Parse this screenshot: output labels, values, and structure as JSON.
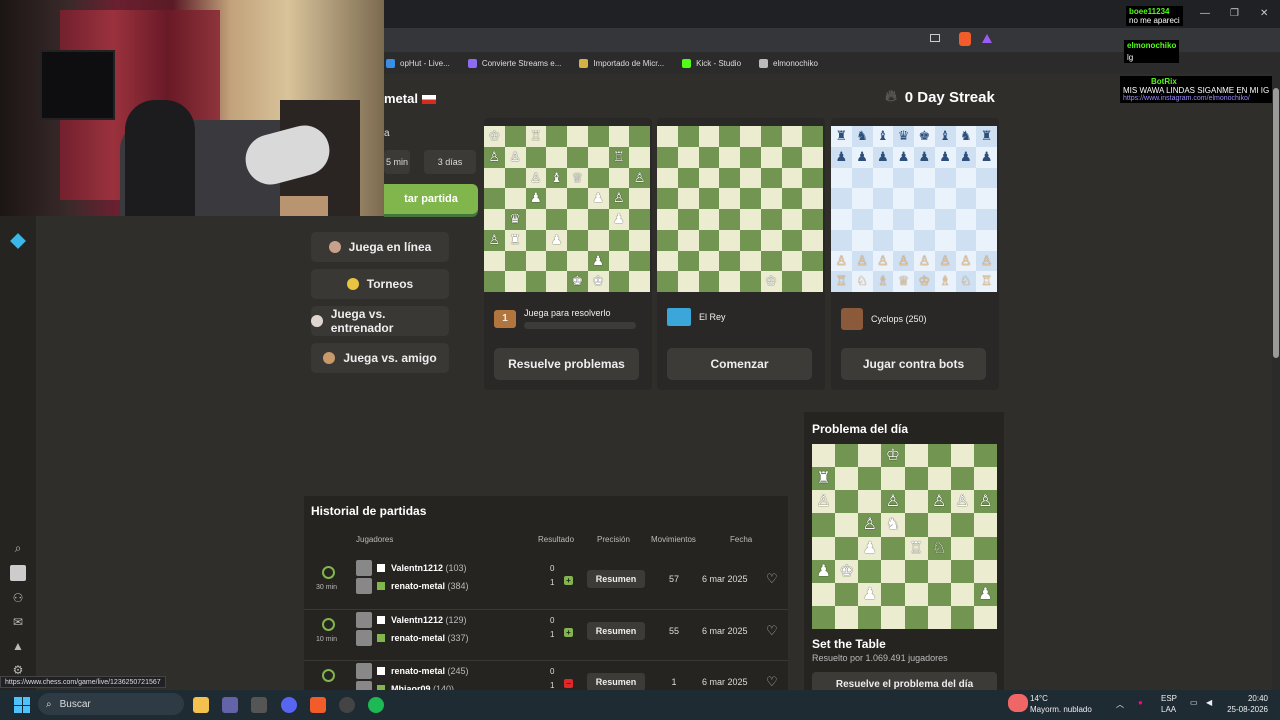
{
  "bookmarks": [
    {
      "label": "opHut - Live...",
      "color": "#3a8ee6"
    },
    {
      "label": "Convierte Streams e...",
      "color": "#8c6cf0"
    },
    {
      "label": "Importado de Micr...",
      "color": "#d6b245"
    },
    {
      "label": "Kick - Studio",
      "color": "#53fc18"
    },
    {
      "label": "elmonochiko",
      "color": "#bbbbbb"
    }
  ],
  "profile": {
    "name": "metal",
    "subtitle": "a"
  },
  "time_controls": [
    "5 min",
    "3 días"
  ],
  "play_button": "tar partida",
  "menu": [
    {
      "label": "Juega en línea",
      "icon": "pawn-icon",
      "icon_color": "#c9a08a"
    },
    {
      "label": "Torneos",
      "icon": "trophy-icon",
      "icon_color": "#e8c440"
    },
    {
      "label": "Juega vs. entrenador",
      "icon": "coach-icon",
      "icon_color": "#e0d6cf"
    },
    {
      "label": "Juega vs. amigo",
      "icon": "handshake-icon",
      "icon_color": "#c89a6a"
    }
  ],
  "streak": {
    "text": "0 Day Streak",
    "icon": "flame-icon"
  },
  "cards": [
    {
      "subtitle": "Juega para resolverlo",
      "button": "Resuelve problemas",
      "badge": "1"
    },
    {
      "subtitle": "El Rey",
      "button": "Comenzar"
    },
    {
      "subtitle": "Cyclops",
      "subtitle_extra": "(250)",
      "button": "Jugar contra bots"
    }
  ],
  "history": {
    "title": "Historial de partidas",
    "columns": [
      "Jugadores",
      "Resultado",
      "Precisión",
      "Movimientos",
      "Fecha"
    ],
    "rows": [
      {
        "time": "30 min",
        "p1": "Valentn1212",
        "p1_rating": "(103)",
        "p2": "renato-metal",
        "p2_rating": "(384)",
        "r1": "0",
        "r2": "1",
        "outcome": "win",
        "action": "Resumen",
        "moves": "57",
        "date": "6 mar 2025"
      },
      {
        "time": "10 min",
        "p1": "Valentn1212",
        "p1_rating": "(129)",
        "p2": "renato-metal",
        "p2_rating": "(337)",
        "r1": "0",
        "r2": "1",
        "outcome": "win",
        "action": "Resumen",
        "moves": "55",
        "date": "6 mar 2025"
      },
      {
        "time": "",
        "p1": "renato-metal",
        "p1_rating": "(245)",
        "p2": "Mhiaor09",
        "p2_rating": "(140)",
        "r1": "0",
        "r2": "1",
        "outcome": "loss",
        "action": "Resumen",
        "moves": "1",
        "date": "6 mar 2025"
      }
    ]
  },
  "puzzle": {
    "title": "Problema del día",
    "name": "Set the Table",
    "solved": "Resuelto por 1.069.491 jugadores",
    "button": "Resuelve el problema del día"
  },
  "chat": {
    "lines": [
      {
        "user": "boee11234",
        "text": "no me apareci",
        "user_color": "#ffffff"
      },
      {
        "user": "elmonochiko",
        "text": "lg",
        "user_color": "#53fc18"
      },
      {
        "user": "BotRix",
        "text": "MIS WAWA LINDAS SIGANME EN MI IG",
        "user_color": "#53fc18"
      }
    ],
    "link": "https://www.instagram.com/elmonochiko/"
  },
  "status_url": "https://www.chess.com/game/live/1236250721567",
  "taskbar": {
    "search_placeholder": "Buscar",
    "weather_temp": "14°C",
    "weather_text": "Mayorm. nublado",
    "lang1": "ESP",
    "lang2": "LAA",
    "time": "20:40",
    "date": "25-08-2026"
  },
  "colors": {
    "accent": "#81b64c",
    "board_light": "#ebecd0",
    "board_dark": "#739552"
  }
}
